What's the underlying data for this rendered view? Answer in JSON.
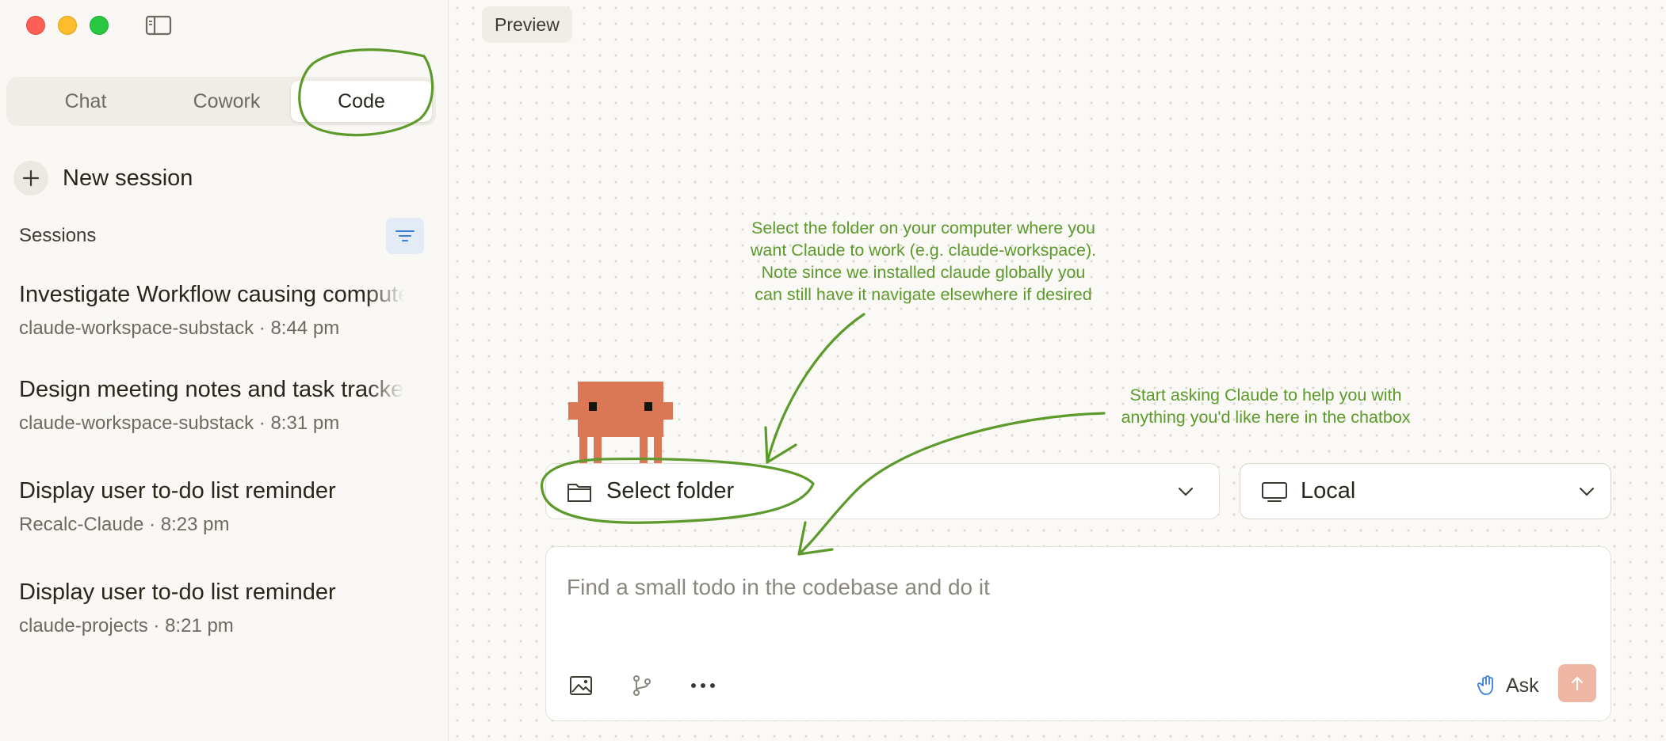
{
  "window": {
    "controls": [
      "close-icon",
      "minimize-icon",
      "maximize-icon"
    ],
    "sidebar_toggle_icon": "sidebar-toggle-icon"
  },
  "sidebar": {
    "mode_tabs": [
      {
        "label": "Chat",
        "active": false
      },
      {
        "label": "Cowork",
        "active": false
      },
      {
        "label": "Code",
        "active": true
      }
    ],
    "new_session_label": "New session",
    "sessions_title": "Sessions",
    "filter_icon": "filter-icon",
    "sessions": [
      {
        "title": "Investigate Workflow causing computer",
        "meta": "claude-workspace-substack · 8:44 pm"
      },
      {
        "title": "Design meeting notes and task tracker",
        "meta": "claude-workspace-substack · 8:31 pm"
      },
      {
        "title": "Display user to-do list reminder",
        "meta": "Recalc-Claude · 8:23 pm"
      },
      {
        "title": "Display user to-do list reminder",
        "meta": "claude-projects · 8:21 pm"
      }
    ]
  },
  "main": {
    "preview_label": "Preview",
    "folder_select_label": "Select folder",
    "environment_label": "Local",
    "chat": {
      "placeholder": "Find a small todo in the codebase and do it",
      "ask_label": "Ask",
      "tool_icons": [
        "image-icon",
        "branch-icon",
        "more-icon"
      ],
      "send_icon": "arrow-up-icon"
    }
  },
  "annotations": {
    "folder_note": "Select the folder on your computer where you\nwant Claude to work (e.g. claude-workspace).\nNote since we installed claude globally you\ncan still have it navigate elsewhere if desired",
    "chat_note": "Start asking Claude to help you with\nanything you'd like here in the chatbox"
  },
  "colors": {
    "accent": "#d97757",
    "annotation": "#5c9a2c",
    "send_button": "#f0b6a4",
    "filter_button": "#e3ebf5",
    "ask_icon": "#3b7dd8"
  }
}
